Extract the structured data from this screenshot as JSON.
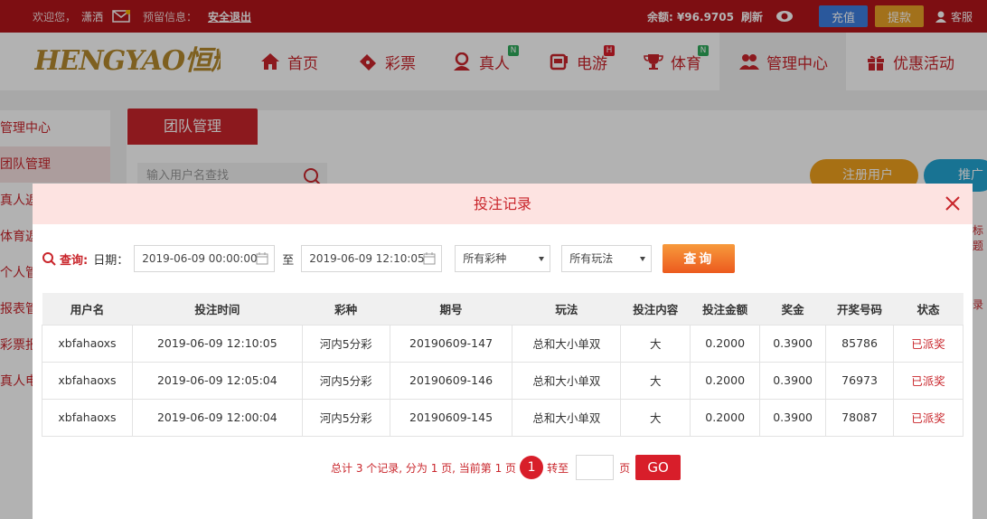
{
  "topbar": {
    "welcome": "欢迎您，",
    "username": "潇洒",
    "notice_label": "预留信息：",
    "logout": "安全退出",
    "balance": "余额: ¥96.9705",
    "refresh": "刷新",
    "recharge": "充值",
    "withdraw": "提款",
    "customer_service": "客服"
  },
  "logo": {
    "text": "HENGYAO恒耀"
  },
  "nav": [
    {
      "label": "首页"
    },
    {
      "label": "彩票"
    },
    {
      "label": "真人",
      "badge": "N"
    },
    {
      "label": "电游",
      "badge": "H"
    },
    {
      "label": "体育",
      "badge": "N"
    },
    {
      "label": "管理中心"
    },
    {
      "label": "优惠活动"
    }
  ],
  "sidebar": [
    {
      "label": "管理中心"
    },
    {
      "label": "团队管理"
    },
    {
      "label": "真人返"
    },
    {
      "label": "体育返"
    },
    {
      "label": "个人管"
    },
    {
      "label": "报表管"
    },
    {
      "label": "彩票报"
    },
    {
      "label": "真人电"
    }
  ],
  "background_panel": {
    "tab": "团队管理",
    "search_placeholder": "输入用户名查找",
    "register": "注册用户",
    "promo": "推广",
    "right_text1": "标题",
    "right_text2": "录"
  },
  "modal": {
    "title": "投注记录",
    "query_label": "查询:",
    "date_label": "日期：",
    "start_date": "2019-06-09 00:00:00",
    "to": "至",
    "end_date": "2019-06-09 12:10:05",
    "lottery_select": "所有彩种",
    "play_select": "所有玩法",
    "query_button": "查询"
  },
  "table": {
    "headers": [
      "用户名",
      "投注时间",
      "彩种",
      "期号",
      "玩法",
      "投注内容",
      "投注金额",
      "奖金",
      "开奖号码",
      "状态"
    ],
    "rows": [
      [
        "xbfahaoxs",
        "2019-06-09 12:10:05",
        "河内5分彩",
        "20190609-147",
        "总和大小单双",
        "大",
        "0.2000",
        "0.3900",
        "85786",
        "已派奖"
      ],
      [
        "xbfahaoxs",
        "2019-06-09 12:05:04",
        "河内5分彩",
        "20190609-146",
        "总和大小单双",
        "大",
        "0.2000",
        "0.3900",
        "76973",
        "已派奖"
      ],
      [
        "xbfahaoxs",
        "2019-06-09 12:00:04",
        "河内5分彩",
        "20190609-145",
        "总和大小单双",
        "大",
        "0.2000",
        "0.3900",
        "78087",
        "已派奖"
      ]
    ]
  },
  "pagination": {
    "summary": "总计 3 个记录, 分为 1 页, 当前第 1 页",
    "current_page": "1",
    "goto": "转至",
    "page_unit": "页",
    "go": "GO"
  },
  "colors": {
    "primary": "#c9252b",
    "topbar": "#b3151b",
    "modal_header": "#fde3e1",
    "query_button": "#f36d26"
  }
}
